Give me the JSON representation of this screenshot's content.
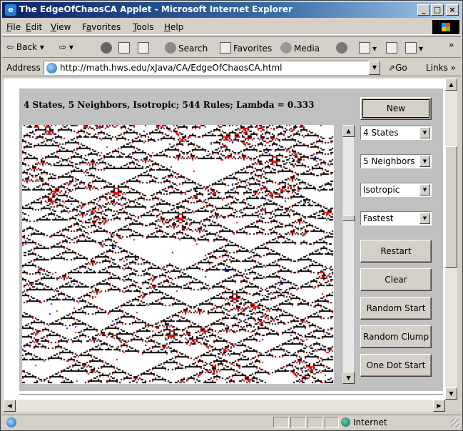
{
  "window": {
    "title": "The EdgeOfChaosCA Applet - Microsoft Internet Explorer",
    "controls": {
      "minimize": "_",
      "maximize": "□",
      "close": "×"
    }
  },
  "menu": {
    "items": [
      {
        "key": "F",
        "rest": "ile"
      },
      {
        "key": "E",
        "rest": "dit"
      },
      {
        "key": "V",
        "rest": "iew"
      },
      {
        "prefix": "F",
        "key": "a",
        "rest": "vorites"
      },
      {
        "key": "T",
        "rest": "ools"
      },
      {
        "key": "H",
        "rest": "elp"
      }
    ]
  },
  "toolbar": {
    "back": "⇦ Back ▾",
    "forward": "⇨ ▾",
    "search": "Search",
    "favorites": "Favorites",
    "media": "Media",
    "overflow": "»"
  },
  "address": {
    "label": "Address",
    "url": "http://math.hws.edu/xJava/CA/EdgeOfChaosCA.html",
    "go": "Go",
    "links": "Links »"
  },
  "applet": {
    "heading": "4 States, 5 Neighbors, Isotropic; 544 Rules; Lambda = 0.333",
    "buttons": {
      "new": "New",
      "restart": "Restart",
      "clear": "Clear",
      "random_start": "Random Start",
      "random_clump": "Random Clump",
      "one_dot_start": "One Dot Start"
    },
    "selects": {
      "states": "4 States",
      "neighbors": "5 Neighbors",
      "symmetry": "Isotropic",
      "speed": "Fastest"
    },
    "colors": {
      "background": "#ffffff",
      "state1": "#d01010",
      "state2": "#1010c8",
      "state3": "#000000"
    }
  },
  "status": {
    "zone": "Internet"
  }
}
